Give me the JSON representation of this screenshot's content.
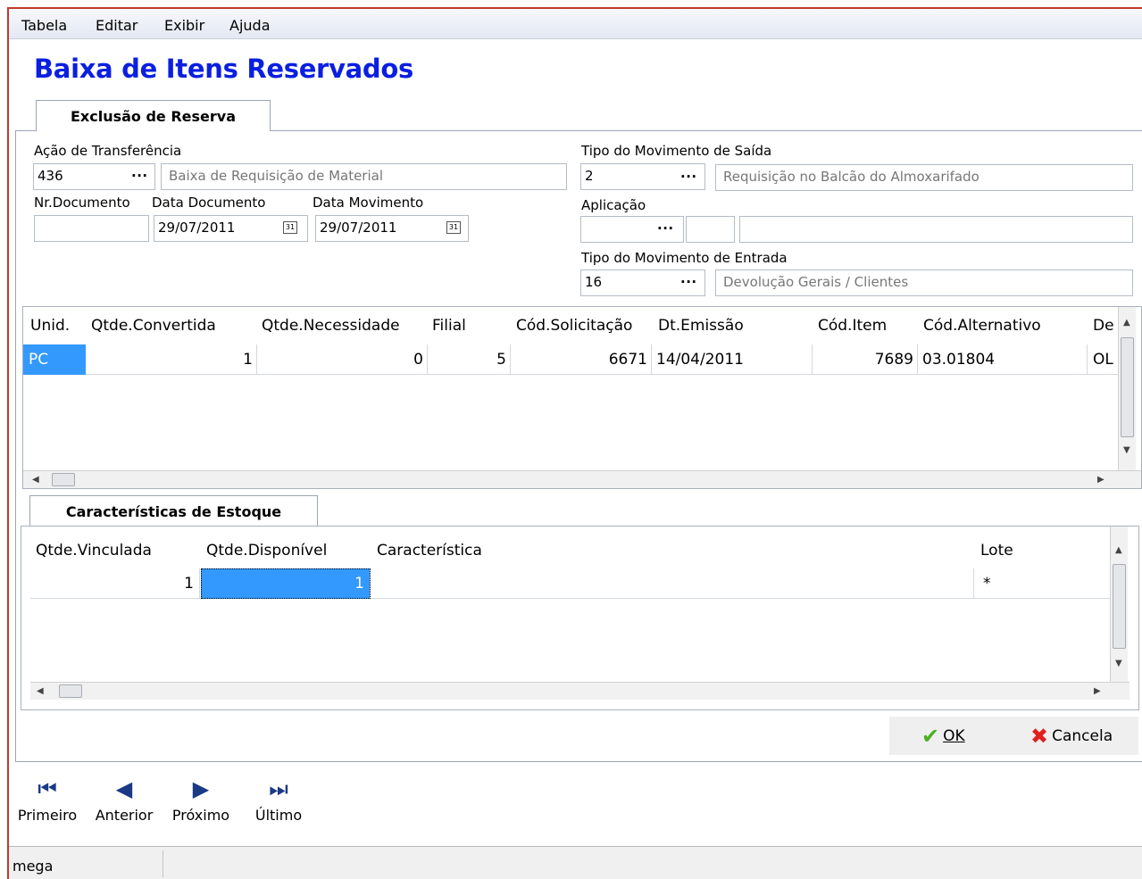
{
  "menu": [
    "Tabela",
    "Editar",
    "Exibir",
    "Ajuda"
  ],
  "page_title": "Baixa de Itens Reservados",
  "tabs": {
    "main": "Exclusão de Reserva",
    "stock": "Características de Estoque"
  },
  "form": {
    "acao_label": "Ação de Transferência",
    "acao_code": "436",
    "acao_desc": "Baixa de Requisição de Material",
    "nrdoc_label": "Nr.Documento",
    "nrdoc_value": "",
    "datadoc_label": "Data Documento",
    "datadoc_value": "29/07/2011",
    "datamov_label": "Data Movimento",
    "datamov_value": "29/07/2011",
    "saida_label": "Tipo do Movimento de Saída",
    "saida_code": "2",
    "saida_desc": "Requisição no Balcão do Almoxarifado",
    "aplic_label": "Aplicação",
    "aplic_code": "",
    "aplic_extra": "",
    "aplic_desc": "",
    "entrada_label": "Tipo do Movimento de Entrada",
    "entrada_code": "16",
    "entrada_desc": "Devolução  Gerais / Clientes",
    "lookup_glyph": "···",
    "calendar_glyph": "31"
  },
  "items_grid": {
    "headers": [
      "Unid.",
      "Qtde.Convertida",
      "Qtde.Necessidade",
      "Filial",
      "Cód.Solicitação",
      "Dt.Emissão",
      "Cód.Item",
      "Cód.Alternativo",
      "De"
    ],
    "row": [
      "PC",
      "1",
      "0",
      "5",
      "6671",
      "14/04/2011",
      "7689",
      "03.01804",
      "OL"
    ]
  },
  "stock_grid": {
    "headers": [
      "Qtde.Vinculada",
      "Qtde.Disponível",
      "Característica",
      "Lote"
    ],
    "row": [
      "1",
      "1",
      "",
      "*"
    ]
  },
  "buttons": {
    "ok": "OK",
    "cancel": "Cancela"
  },
  "nav": {
    "first": "Primeiro",
    "prev": "Anterior",
    "next": "Próximo",
    "last": "Último"
  },
  "status": {
    "user": "mega"
  },
  "colors": {
    "title": "#0a1fe0",
    "selection": "#3399ff",
    "ok_check": "#4caf20",
    "cancel_x": "#e02020",
    "nav_icon": "#1a3a86"
  }
}
